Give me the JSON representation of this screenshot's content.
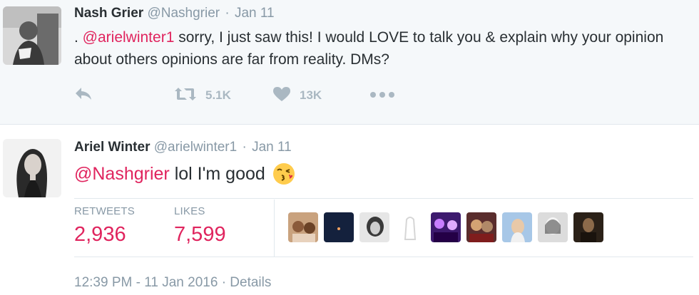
{
  "parent_tweet": {
    "fullname": "Nash Grier",
    "handle": "@Nashgrier",
    "separator": "·",
    "date": "Jan 11",
    "text_prefix": ". ",
    "mention": "@arielwinter1",
    "text_body": " sorry, I just saw this! I would LOVE to talk you & explain why your opinion about others opinions are far from reality. DMs?",
    "actions": {
      "reply_icon": "reply-icon",
      "retweet_icon": "retweet-icon",
      "retweet_count": "5.1K",
      "like_icon": "heart-icon",
      "like_count": "13K",
      "more_icon": "more-dots-icon"
    }
  },
  "reply_tweet": {
    "fullname": "Ariel Winter",
    "handle": "@arielwinter1",
    "separator": "·",
    "date": "Jan 11",
    "mention": "@Nashgrier",
    "text_body": " lol I'm good",
    "emoji": "kissing-face-emoji",
    "stats": {
      "retweets_label": "RETWEETS",
      "retweets_value": "2,936",
      "likes_label": "LIKES",
      "likes_value": "7,599"
    },
    "liker_count_shown": 9,
    "timestamp": "12:39 PM - 11 Jan 2016",
    "separator_2": "·",
    "details_link": "Details"
  },
  "colors": {
    "accent_mention": "#e0245e",
    "muted_text": "#8899a6",
    "icon_gray": "#aab8c2",
    "parent_bg": "#f5f8fa"
  }
}
